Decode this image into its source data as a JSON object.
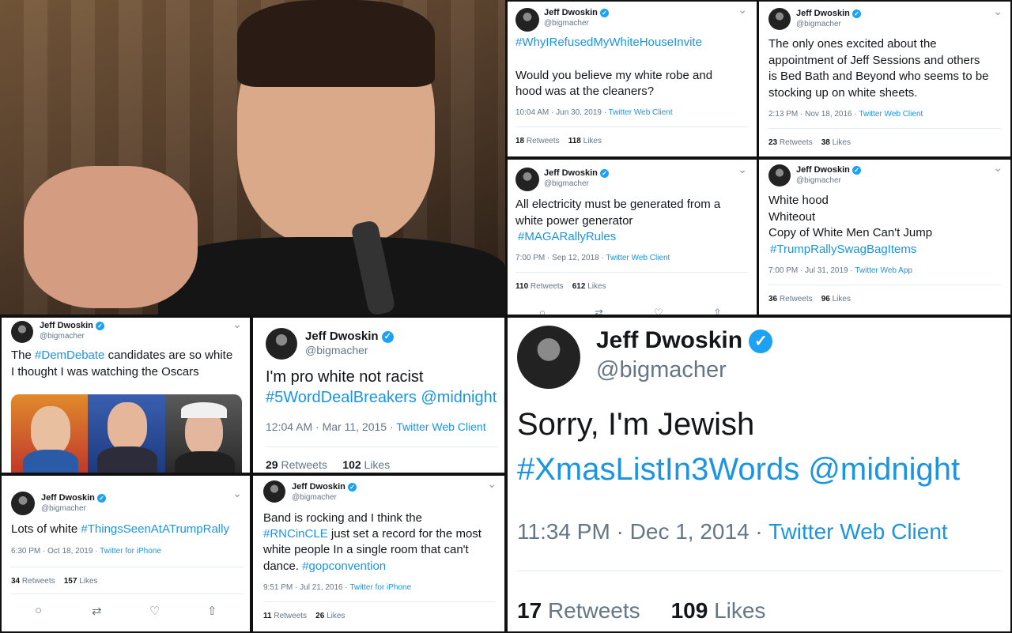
{
  "user": {
    "name": "Jeff Dwoskin",
    "handle": "@bigmacher",
    "verified_mark": "✓"
  },
  "tweets": [
    {
      "hashtag": "#WhyIRefusedMyWhiteHouseInvite",
      "text1": "Would you believe my white robe and",
      "text2": "hood was at the cleaners?",
      "time": "10:04 AM · Jun 30, 2019 · ",
      "source": "Twitter Web Client",
      "retweets": "18",
      "likes": "118"
    },
    {
      "text1": "The only ones excited about the",
      "text2": "appointment of Jeff Sessions and others",
      "text3": "is Bed Bath and Beyond who seems to be",
      "text4": "stocking up on white sheets.",
      "time": "2:13 PM · Nov 18, 2016 · ",
      "source": "Twitter Web Client",
      "retweets": "23",
      "likes": "38"
    },
    {
      "text1": "All electricity must be generated from a",
      "text2": "white power generator",
      "hashtag": "#MAGARallyRules",
      "time": "7:00 PM · Sep 12, 2018 · ",
      "source": "Twitter Web Client",
      "retweets": "110",
      "likes": "612"
    },
    {
      "text1": "White hood",
      "text2": "Whiteout",
      "text3": "Copy of White Men Can't Jump",
      "hashtag": "#TrumpRallySwagBagItems",
      "time": "7:00 PM · Jul 31, 2019 · ",
      "source": "Twitter Web App",
      "retweets": "36",
      "likes": "96"
    },
    {
      "text_a": "The ",
      "hashtag": "#DemDebate",
      "text_b": " candidates are so white",
      "text2": "I thought I was watching the Oscars"
    },
    {
      "text1": "I'm pro white not racist",
      "hashtag": "#5WordDealBreakers @midnight",
      "time": "12:04 AM · Mar 11, 2015 · ",
      "source": "Twitter Web Client",
      "retweets": "29",
      "likes": "102"
    },
    {
      "text": "Lots of white ",
      "hashtag": "#ThingsSeenAtATrumpRally",
      "time": "6:30 PM · Oct 18, 2019 · ",
      "source": "Twitter for iPhone",
      "retweets": "34",
      "likes": "157"
    },
    {
      "text1": "Band is rocking and I think the",
      "hashtag1": "#RNCinCLE",
      "text2": " just set a record for the most",
      "text3": "white people In a single room that can't",
      "text4": "dance. ",
      "hashtag2": "#gopconvention",
      "time": "9:51 PM · Jul 21, 2016 · ",
      "source": "Twitter for iPhone",
      "retweets": "11",
      "likes": "26"
    },
    {
      "text1": "Sorry, I'm Jewish",
      "hashtag": "#XmasListIn3Words @midnight",
      "time": "11:34 PM · Dec 1, 2014 · ",
      "source": "Twitter Web Client",
      "retweets": "17",
      "likes": "109"
    }
  ],
  "labels": {
    "retweets": "Retweets",
    "likes": "Likes"
  },
  "icons": {
    "chevron": "⌄",
    "reply": "○",
    "retweet": "⇄",
    "like": "♡",
    "share": "⇧"
  },
  "colors": {
    "link": "#1b95e0",
    "verified": "#1da1f2",
    "muted": "#657786"
  }
}
